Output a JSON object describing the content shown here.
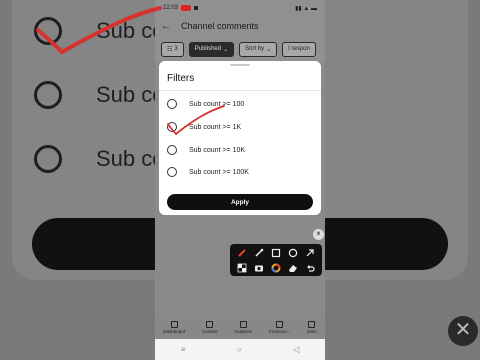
{
  "status_bar": {
    "time": "22:03"
  },
  "app_bar": {
    "title": "Channel comments"
  },
  "chips": [
    {
      "label": "3",
      "dark": false
    },
    {
      "label": "Published",
      "dark": true
    },
    {
      "label": "Sort by",
      "dark": false
    },
    {
      "label": "I respon",
      "dark": false
    }
  ],
  "background": {
    "rows": [
      "Sub count",
      "Sub count",
      "Sub count"
    ]
  },
  "dialog": {
    "title": "Filters",
    "options": [
      {
        "label": "Sub count >= 100",
        "selected": false
      },
      {
        "label": "Sub count >= 1K",
        "selected": false
      },
      {
        "label": "Sub count >= 10K",
        "selected": false
      },
      {
        "label": "Sub count >= 100K",
        "selected": false
      }
    ],
    "apply_label": "Apply"
  },
  "bottom_nav": [
    {
      "label": "Dashboard"
    },
    {
      "label": "Content"
    },
    {
      "label": "Analytics"
    },
    {
      "label": "Commun..."
    },
    {
      "label": "Earn"
    }
  ],
  "system_nav": {
    "menu": "≡",
    "home": "○",
    "back": "◁"
  },
  "toolbar": {
    "tools": [
      "pen-icon",
      "marker-icon",
      "rectangle-icon",
      "circle-icon",
      "arrow-icon",
      "mosaic-icon",
      "camera-icon",
      "color-icon",
      "eraser-icon",
      "undo-icon"
    ],
    "close": "×"
  },
  "background_close": "✕",
  "colors": {
    "ink": "#d6312e",
    "accent_dark": "#0f0f0f"
  }
}
